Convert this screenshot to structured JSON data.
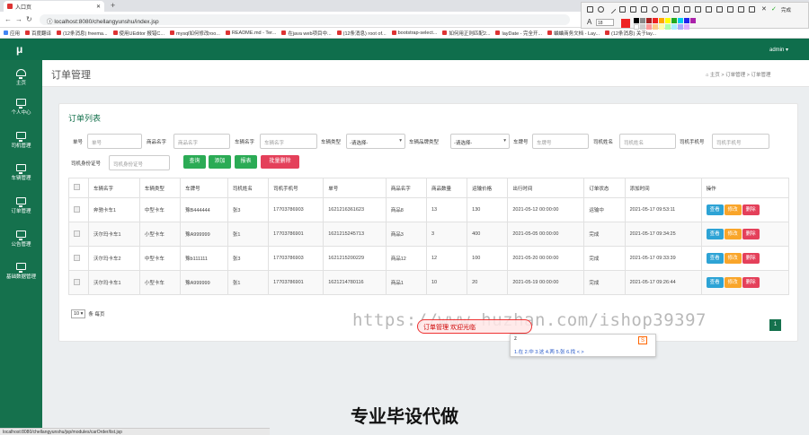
{
  "browser": {
    "tab_title": "入口页",
    "new_tab": "+",
    "url": "localhost:8080/chellangyunshu/index.jsp",
    "bookmarks": [
      "应用",
      "百度翻译",
      "(12条消息) freema...",
      "使用UEditor 报错C...",
      "mysql如何修改roo...",
      "README.md - Ter...",
      "在java web项目中...",
      "(12条消息) root of...",
      "bootstrap-select...",
      "如何用正则匹配2...",
      "layDate - 完全开...",
      "蛐蛐商务文档 - Lay...",
      "(12条消息) 关于lay..."
    ],
    "annot_font_size": "18",
    "annot_done": "完成"
  },
  "colors": {
    "primary": "#15714d",
    "success": "#2bab55",
    "danger": "#e4405a",
    "info": "#2da3d5",
    "warning": "#f9a52a"
  },
  "topbar": {
    "logo": "μ",
    "user": "admin ▾"
  },
  "sidebar": {
    "items": [
      {
        "label": "主页",
        "icon": "dashboard-icon"
      },
      {
        "label": "个人中心",
        "icon": "monitor-icon"
      },
      {
        "label": "司机管理",
        "icon": "monitor-icon"
      },
      {
        "label": "车辆管理",
        "icon": "monitor-icon"
      },
      {
        "label": "订单管理",
        "icon": "monitor-icon"
      },
      {
        "label": "公告管理",
        "icon": "monitor-icon"
      },
      {
        "label": "基础数据管理",
        "icon": "monitor-icon"
      }
    ]
  },
  "page": {
    "title": "订单管理",
    "breadcrumb": {
      "home": "主页",
      "parent": "订单管理",
      "current": "订单管理",
      "sep": ">"
    }
  },
  "card": {
    "title": "订单列表"
  },
  "filters": {
    "order_no": {
      "label": "单号",
      "placeholder": "单号"
    },
    "goods": {
      "label": "商品名字",
      "placeholder": "商品名字"
    },
    "vehicle": {
      "label": "车辆名字",
      "placeholder": "车辆名字"
    },
    "vehicle_type": {
      "label": "车辆类型",
      "value": "-请选择-"
    },
    "vehicle_brand": {
      "label": "车辆品牌类型",
      "value": "-请选择-"
    },
    "plate": {
      "label": "车牌号",
      "placeholder": "车牌号"
    },
    "driver": {
      "label": "司机姓名",
      "placeholder": "司机姓名"
    },
    "phone": {
      "label": "司机手机号",
      "placeholder": "司机手机号"
    },
    "idcard": {
      "label": "司机身份证号",
      "placeholder": "司机身份证号"
    }
  },
  "buttons": {
    "search": "查询",
    "add": "添加",
    "report": "报表",
    "batch_delete": "批量删除"
  },
  "table": {
    "headers": [
      "车辆名字",
      "车辆类型",
      "车牌号",
      "司机姓名",
      "司机手机号",
      "单号",
      "商品名字",
      "商品数量",
      "运输价格",
      "出行时间",
      "订单状态",
      "添加时间",
      "操作"
    ],
    "rows": [
      [
        "奔驰卡车1",
        "中型卡车",
        "豫B444444",
        "张3",
        "17703786903",
        "1621216361623",
        "商品8",
        "13",
        "130",
        "2021-05-12 00:00:00",
        "运输中",
        "2021-05-17 09:53:11"
      ],
      [
        "沃尔玛卡车1",
        "小型卡车",
        "豫A999999",
        "张1",
        "17703786901",
        "1621215245713",
        "商品3",
        "3",
        "400",
        "2021-05-05 00:00:00",
        "完成",
        "2021-05-17 09:34:25"
      ],
      [
        "沃尔玛卡车2",
        "中型卡车",
        "豫b111111",
        "张3",
        "17703786903",
        "1621215200229",
        "商品12",
        "12",
        "100",
        "2021-05-20 00:00:00",
        "完成",
        "2021-05-17 09:33:39"
      ],
      [
        "沃尔玛卡车1",
        "小型卡车",
        "豫A999999",
        "张1",
        "17703786901",
        "1621214780116",
        "商品1",
        "10",
        "20",
        "2021-05-19 00:00:00",
        "完成",
        "2021-05-17 09:26:44"
      ]
    ],
    "actions": {
      "view": "查看",
      "edit": "修改",
      "delete": "删除"
    }
  },
  "pagination": {
    "per_page": "10",
    "per_page_suffix": "条 每页",
    "current_page": "1"
  },
  "overlay": {
    "watermark": "https://www.huzhan.com/ishop39397",
    "pill_text": "订单管理 欢迎光临",
    "ime_input": "z",
    "ime_candidates": "1.在  2.中  3.这  4.两  5.张  6.找  < >",
    "caption": "专业毕设代做"
  },
  "status_url": "localhost:8080/chellangyunshu/jsp/modules/carOrder/list.jsp"
}
